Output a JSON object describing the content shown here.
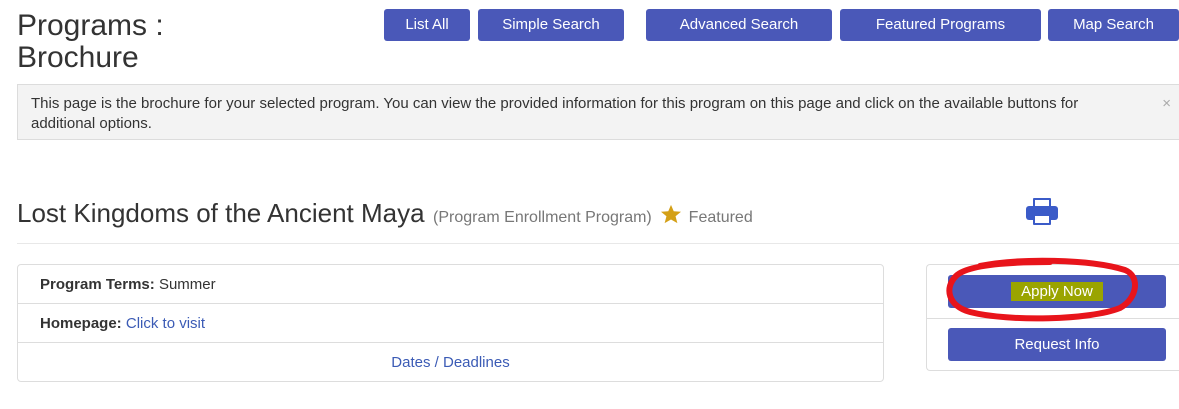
{
  "page": {
    "title": "Programs : Brochure"
  },
  "nav": {
    "buttons": [
      {
        "label": "List All"
      },
      {
        "label": "Simple Search"
      },
      {
        "label": "Advanced Search"
      },
      {
        "label": "Featured Programs"
      },
      {
        "label": "Map Search"
      }
    ]
  },
  "alert": {
    "message": "This page is the brochure for your selected program. You can view the provided information for this program on this page and click on the available buttons for additional options.",
    "close_glyph": "×"
  },
  "program": {
    "name": "Lost Kingdoms of the Ancient Maya",
    "type": "(Program Enrollment Program)",
    "featured_label": "Featured",
    "star_color": "#d4a017"
  },
  "details": {
    "terms_label": "Program Terms:",
    "terms_value": "Summer",
    "homepage_label": "Homepage:",
    "homepage_link": "Click to visit",
    "dates_link": "Dates / Deadlines"
  },
  "actions": {
    "apply_label": "Apply Now",
    "request_label": "Request Info"
  },
  "colors": {
    "accent": "#4a58b8",
    "link": "#3b5bb5",
    "annotation": "#e8141b",
    "highlight": "#9aa400"
  }
}
